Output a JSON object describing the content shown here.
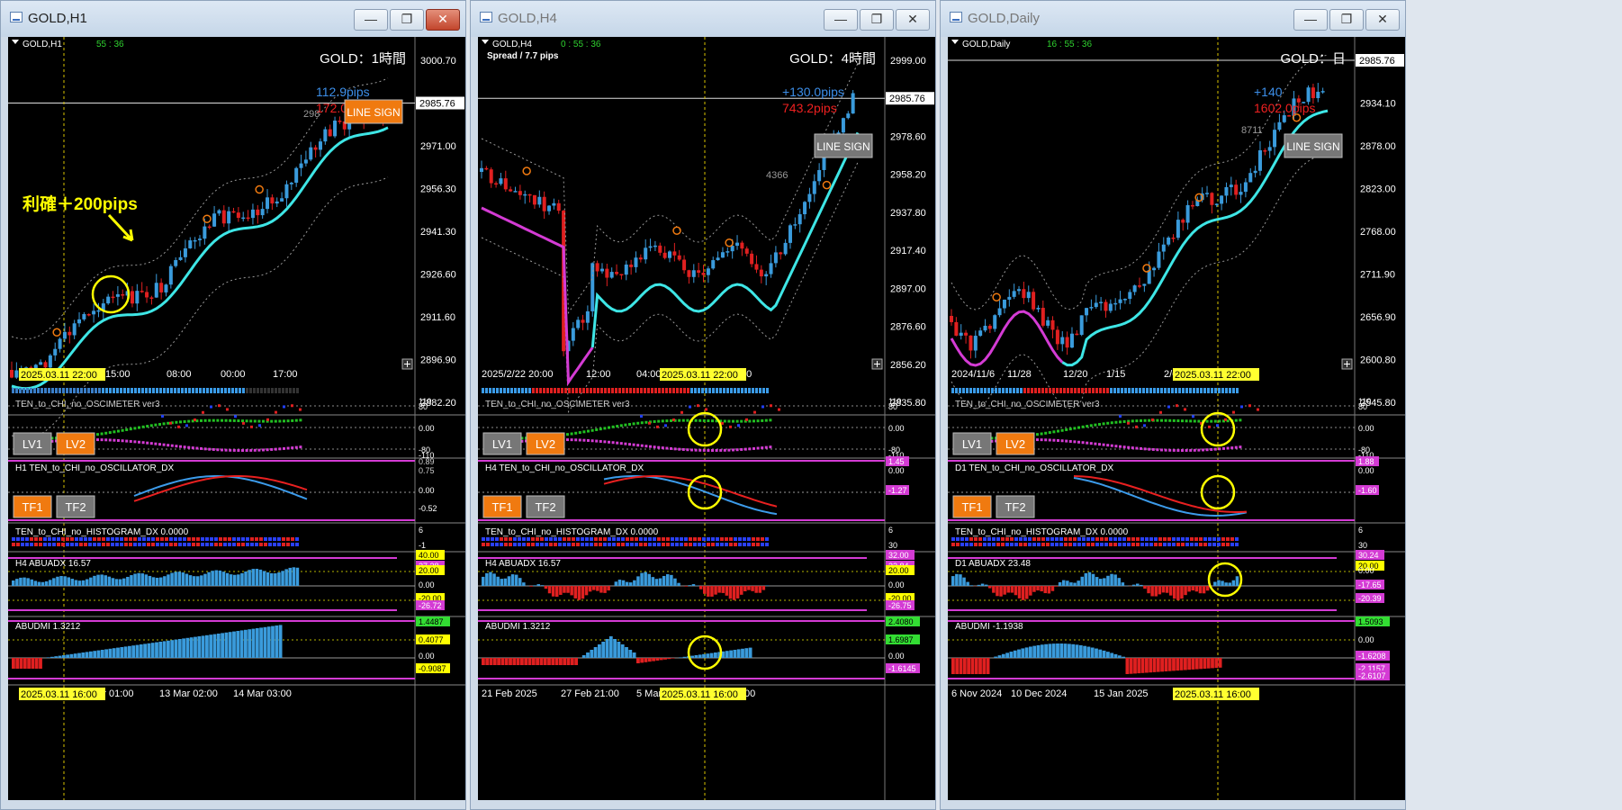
{
  "windows": [
    {
      "title": "GOLD,H1",
      "active": true,
      "symbol_label": "GOLD,H1",
      "countdown": "55 : 36",
      "spread": "",
      "heading": "GOLD：1時間",
      "pips_blue": "112.9pips",
      "pips_red": "172.0pips",
      "sign_button": "LINE SIGN",
      "ma_value": "298",
      "current_price": "2985.76",
      "price_ticks": [
        "3000.70",
        "2985.76",
        "2971.00",
        "2956.30",
        "2941.30",
        "2926.60",
        "2911.60",
        "2896.90",
        "2882.20"
      ],
      "time_ticks": [
        "15:00",
        "08:00",
        "00:00",
        "17:00"
      ],
      "time_highlight": "2025.03.11 22:00",
      "annotation": "利確＋200pips",
      "osc_meter_title": "TEN_to_CHI_no_OSCIMETER ver3",
      "osc_meter_axis": [
        "110",
        "80",
        "0.00",
        "-80",
        "-110"
      ],
      "lv_buttons": [
        "LV1",
        "LV2"
      ],
      "osc_dx_title": "H1 TEN_to_CHI_no_OSCILLATOR_DX",
      "osc_dx_axis": [
        "0.89",
        "0.75",
        "0.00",
        "-0.52"
      ],
      "tf_buttons": [
        "TF1",
        "TF2"
      ],
      "hist_title": "TEN_to_CHI_no_HISTOGRAM_DX 0.0000",
      "hist_axis": [
        "6",
        "-1"
      ],
      "abuadx_title": "H4 ABUADX  16.57",
      "abuadx_axis": [
        "40.00",
        "27.28",
        "20.00",
        "0.00",
        "-20.00",
        "-26.72"
      ],
      "abudmi_title": "ABUDMI  1.3212",
      "abudmi_axis": [
        "1.4487",
        "0.4077",
        "0.00",
        "-0.9087"
      ],
      "bottom_ticks": [
        "Mar 01:00",
        "13 Mar 02:00",
        "14 Mar 03:00"
      ],
      "bottom_highlight": "2025.03.11 16:00"
    },
    {
      "title": "GOLD,H4",
      "active": false,
      "symbol_label": "GOLD,H4",
      "countdown": "0 : 55 : 36",
      "spread": "Spread / 7.7 pips",
      "heading": "GOLD：4時間",
      "pips_blue": "+130.0pips",
      "pips_red": "743.2pips",
      "sign_button": "LINE SIGN",
      "ma_value": "4366",
      "current_price": "2985.76",
      "price_ticks": [
        "2999.00",
        "2985.76",
        "2978.60",
        "2958.20",
        "2937.80",
        "2917.40",
        "2897.00",
        "2876.60",
        "2856.20",
        "2835.80"
      ],
      "time_ticks": [
        "2025/2/22 20:00",
        "12:00",
        "04:00",
        "00"
      ],
      "time_highlight": "2025.03.11 22:00",
      "annotation": "",
      "osc_meter_title": "TEN_to_CHI_no_OSCIMETER ver3",
      "osc_meter_axis": [
        "110",
        "80",
        "0.00",
        "-80",
        "-110"
      ],
      "lv_buttons": [
        "LV1",
        "LV2"
      ],
      "osc_dx_title": "H4 TEN_to_CHI_no_OSCILLATOR_DX",
      "osc_dx_axis": [
        "1.45",
        "0.00",
        "-1.27"
      ],
      "tf_buttons": [
        "TF1",
        "TF2"
      ],
      "hist_title": "TEN_to_CHI_no_HISTOGRAM_DX 0.0000",
      "hist_axis": [
        "6",
        "30"
      ],
      "abuadx_title": "H4 ABUADX  16.57",
      "abuadx_axis": [
        "32.00",
        "32.84",
        "20.00",
        "0.00",
        "-20.00",
        "-26.75"
      ],
      "abudmi_title": "ABUDMI  1.3212",
      "abudmi_axis": [
        "2.4080",
        "1.6987",
        "0.00",
        "-1.6145"
      ],
      "bottom_ticks": [
        "21 Feb 2025",
        "27 Feb 21:00",
        "5 Mar",
        "00"
      ],
      "bottom_highlight": "2025.03.11 16:00"
    },
    {
      "title": "GOLD,Daily",
      "active": false,
      "symbol_label": "GOLD,Daily",
      "countdown": "16 : 55 : 36",
      "spread": "",
      "heading": "GOLD：日",
      "pips_blue": "+140",
      "pips_red": "1602.0pips",
      "sign_button": "LINE SIGN",
      "ma_value": "8711",
      "current_price": "2985.76",
      "price_ticks": [
        "2985.76",
        "2934.10",
        "2878.00",
        "2823.00",
        "2768.00",
        "2711.90",
        "2656.90",
        "2600.80",
        "2545.80"
      ],
      "time_ticks": [
        "2024/11/6",
        "11/28",
        "12/20",
        "1/15",
        "2/6"
      ],
      "time_highlight": "2025.03.11 22:00",
      "annotation": "",
      "osc_meter_title": "TEN_to_CHI_no_OSCIMETER ver3",
      "osc_meter_axis": [
        "110",
        "80",
        "0.00",
        "-80",
        "-110"
      ],
      "lv_buttons": [
        "LV1",
        "LV2"
      ],
      "osc_dx_title": "D1 TEN_to_CHI_no_OSCILLATOR_DX",
      "osc_dx_axis": [
        "1.88",
        "0.00",
        "-1.60"
      ],
      "tf_buttons": [
        "TF1",
        "TF2"
      ],
      "hist_title": "TEN_to_CHI_no_HISTOGRAM_DX 0.0000",
      "hist_axis": [
        "6",
        "30"
      ],
      "abuadx_title": "D1 ABUADX  23.48",
      "abuadx_axis": [
        "30.24",
        "20.00",
        "0.00",
        "-17.65",
        "-20.39"
      ],
      "abudmi_title": "ABUDMI  -1.1938",
      "abudmi_axis": [
        "1.5093",
        "0.00",
        "-1.6208",
        "-2.1157",
        "-2.6107"
      ],
      "bottom_ticks": [
        "6 Nov 2024",
        "10 Dec 2024",
        "15 Jan 2025"
      ],
      "bottom_highlight": "2025.03.11 16:00"
    }
  ],
  "colors": {
    "bull": "#3a9bdc",
    "bear": "#e02020",
    "ma_cyan": "#3ee6e6",
    "ma_magenta": "#d43bd4",
    "orange": "#f07a10",
    "yellow": "#ffff00",
    "highlight": "#ffff30"
  }
}
